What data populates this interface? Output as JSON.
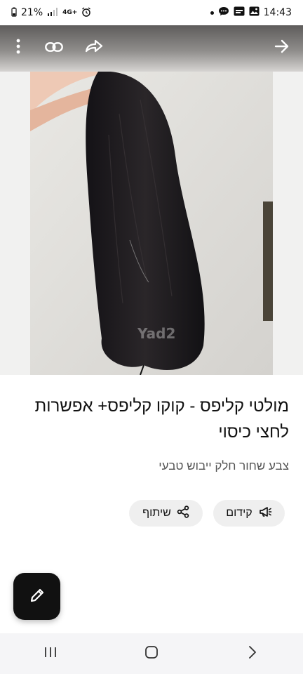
{
  "status_bar": {
    "battery": "21%",
    "signal": "4G+",
    "time": "14:43"
  },
  "top_bar": {
    "icons": [
      "more-vertical-icon",
      "link-icon",
      "forward-icon",
      "arrow-right-icon"
    ]
  },
  "photo": {
    "watermark": "Yad2"
  },
  "listing": {
    "title": "מולטי קליפס - קוקו קליפס+ אפשרות לחצי כיסוי",
    "subtitle": "צבע שחור חלק ייבוש טבעי",
    "promote_label": "קידום",
    "share_label": "שיתוף"
  },
  "colors": {
    "fab_bg": "#111111",
    "pill_bg": "#efefef",
    "hair": "#1c1a1e"
  },
  "nav_bar": {
    "icons": [
      "recents-icon",
      "home-icon",
      "back-icon"
    ]
  }
}
